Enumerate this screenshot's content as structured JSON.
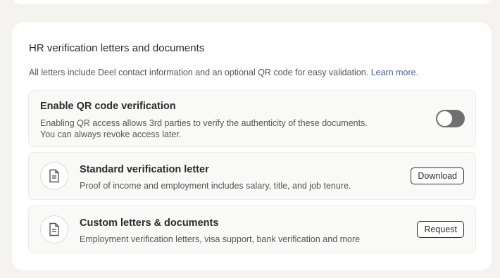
{
  "section": {
    "title": "HR verification letters and documents",
    "description": "All letters include Deel contact information and an optional QR code for easy validation.",
    "learn_more": "Learn more."
  },
  "qr": {
    "title": "Enable QR code verification",
    "description_line1": "Enabling QR access allows 3rd parties to verify the authenticity of these documents.",
    "description_line2": "You can always revoke access later.",
    "enabled": false
  },
  "documents": [
    {
      "title": "Standard verification letter",
      "description": "Proof of income and employment includes salary, title, and job tenure.",
      "action": "Download",
      "icon": "document-icon"
    },
    {
      "title": "Custom letters & documents",
      "description": "Employment verification letters, visa support, bank verification and more",
      "action": "Request",
      "icon": "document-icon"
    }
  ]
}
